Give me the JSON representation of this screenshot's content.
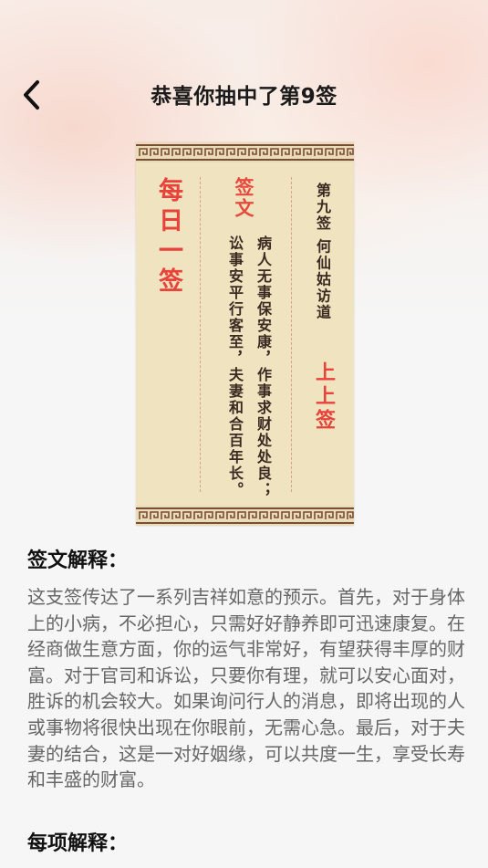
{
  "header": {
    "title": "恭喜你抽中了第9签",
    "back_icon": "chevron-left-icon"
  },
  "card": {
    "daily_label": "每日一签",
    "verse_label": "签文",
    "verse_line_1": "病人无事保安康，作事求财处处良；",
    "verse_line_2": "讼事安平行客至，夫妻和合百年长。",
    "lot_number": "第九签 何仙姑访道",
    "lot_grade": "上上签",
    "colors": {
      "red": "#e8423a",
      "paper": "#efe3c0",
      "ink": "#3a2a22"
    }
  },
  "explanation": {
    "heading": "签文解释：",
    "text": "这支签传达了一系列吉祥如意的预示。首先，对于身体上的小病，不必担心，只需好好静养即可迅速康复。在经商做生意方面，你的运气非常好，有望获得丰厚的财富。对于官司和诉讼，只要你有理，就可以安心面对，胜诉的机会较大。如果询问行人的消息，即将出现的人或事物将很快出现在你眼前，无需心急。最后，对于夫妻的结合，这是一对好姻缘，可以共度一生，享受长寿和丰盛的财富。"
  },
  "details": {
    "heading": "每项解释："
  }
}
